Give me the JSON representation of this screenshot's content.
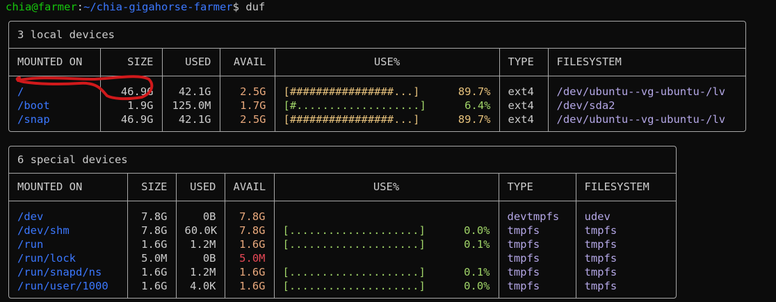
{
  "prompt": {
    "user_host": "chia@farmer",
    "sep": ":",
    "path": "~/chia-gigahorse-farmer",
    "symbol": "$ ",
    "command": "duf"
  },
  "local": {
    "title": "3 local devices",
    "headers": [
      "MOUNTED ON",
      "SIZE",
      "USED",
      "AVAIL",
      "USE%",
      "TYPE",
      "FILESYSTEM"
    ],
    "rows": [
      {
        "mount": "/",
        "size": "46.9G",
        "used": "42.1G",
        "avail": "2.5G",
        "bar": "[################...]",
        "pct": "89.7%",
        "type": "ext4",
        "fs": "/dev/ubuntu--vg-ubuntu-/lv"
      },
      {
        "mount": "/boot",
        "size": "1.9G",
        "used": "125.0M",
        "avail": "1.7G",
        "bar": "[#...................]",
        "pct": "6.4%",
        "type": "ext4",
        "fs": "/dev/sda2"
      },
      {
        "mount": "/snap",
        "size": "46.9G",
        "used": "42.1G",
        "avail": "2.5G",
        "bar": "[################...]",
        "pct": "89.7%",
        "type": "ext4",
        "fs": "/dev/ubuntu--vg-ubuntu-/lv"
      }
    ]
  },
  "special": {
    "title": "6 special devices",
    "headers": [
      "MOUNTED ON",
      "SIZE",
      "USED",
      "AVAIL",
      "USE%",
      "TYPE",
      "FILESYSTEM"
    ],
    "rows": [
      {
        "mount": "/dev",
        "size": "7.8G",
        "used": "0B",
        "avail": "7.8G",
        "bar": "",
        "pct": "",
        "type": "devtmpfs",
        "fs": "udev"
      },
      {
        "mount": "/dev/shm",
        "size": "7.8G",
        "used": "60.0K",
        "avail": "7.8G",
        "bar": "[....................]",
        "pct": "0.0%",
        "type": "tmpfs",
        "fs": "tmpfs"
      },
      {
        "mount": "/run",
        "size": "1.6G",
        "used": "1.2M",
        "avail": "1.6G",
        "bar": "[....................]",
        "pct": "0.1%",
        "type": "tmpfs",
        "fs": "tmpfs"
      },
      {
        "mount": "/run/lock",
        "size": "5.0M",
        "used": "0B",
        "avail": "5.0M",
        "bar": "",
        "pct": "",
        "type": "tmpfs",
        "fs": "tmpfs"
      },
      {
        "mount": "/run/snapd/ns",
        "size": "1.6G",
        "used": "1.2M",
        "avail": "1.6G",
        "bar": "[....................]",
        "pct": "0.1%",
        "type": "tmpfs",
        "fs": "tmpfs"
      },
      {
        "mount": "/run/user/1000",
        "size": "1.6G",
        "used": "4.0K",
        "avail": "1.6G",
        "bar": "[....................]",
        "pct": "0.0%",
        "type": "tmpfs",
        "fs": "tmpfs"
      }
    ]
  },
  "colors": {
    "annotation": "#d0191b"
  }
}
